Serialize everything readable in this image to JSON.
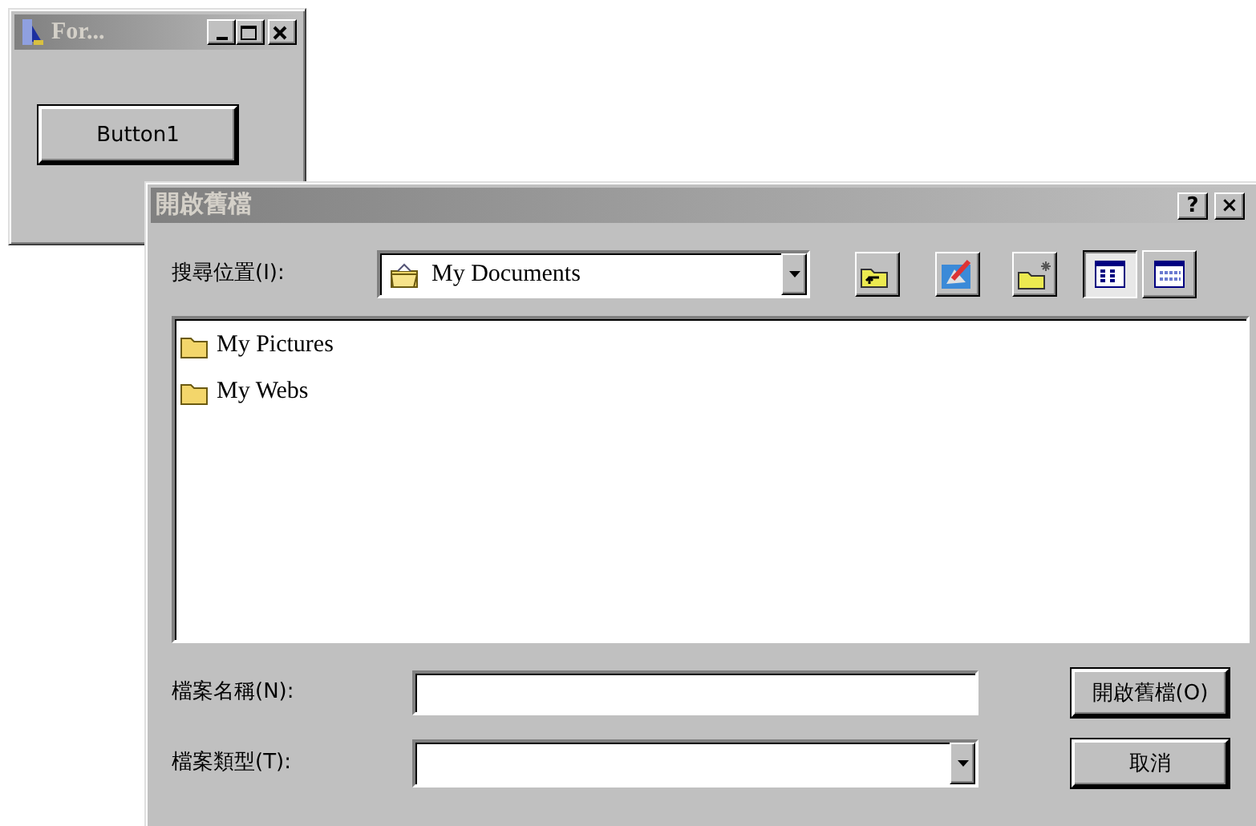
{
  "form_window": {
    "title": "For...",
    "button": "Button1"
  },
  "dialog": {
    "title": "開啟舊檔",
    "look_in_label": "搜尋位置(I):",
    "look_in_value": "My Documents",
    "view_buttons": [
      {
        "selected": true
      },
      {
        "selected": false
      }
    ],
    "files": [
      {
        "name": "My Pictures"
      },
      {
        "name": "My Webs"
      }
    ],
    "file_name_label": "檔案名稱(N):",
    "file_type_label": "檔案類型(T):",
    "open_button": "開啟舊檔(O)",
    "cancel_button": "取消",
    "help_button": "?",
    "close_button": "×"
  }
}
